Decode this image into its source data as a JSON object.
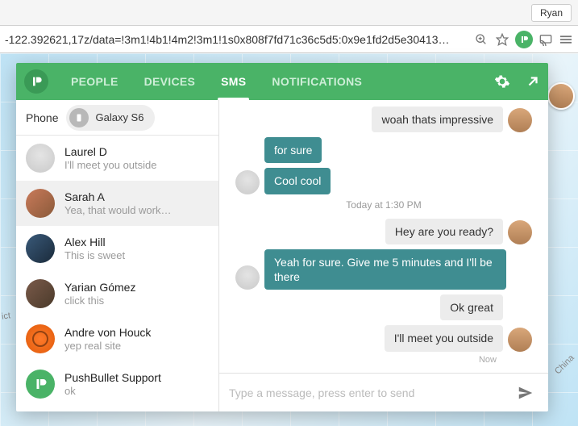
{
  "browser": {
    "user": "Ryan",
    "url": "-122.392621,17z/data=!3m1!4b1!4m2!3m1!1s0x808f7fd71c36c5d5:0x9e1fd2d5e30413…",
    "map_label_left": "ict",
    "map_label_right": "China"
  },
  "nav": {
    "tabs": [
      "PEOPLE",
      "DEVICES",
      "SMS",
      "NOTIFICATIONS"
    ],
    "active_index": 2
  },
  "device": {
    "label": "Phone",
    "name": "Galaxy S6"
  },
  "conversations": [
    {
      "name": "Laurel D",
      "preview": "I'll meet you outside",
      "avatar": "av-grey",
      "selected": false
    },
    {
      "name": "Sarah A",
      "preview": "Yea, that would work…",
      "avatar": "av-photo1",
      "selected": true
    },
    {
      "name": "Alex Hill",
      "preview": "This is sweet",
      "avatar": "av-photo2",
      "selected": false
    },
    {
      "name": "Yarian Gómez",
      "preview": "click this",
      "avatar": "av-photo3",
      "selected": false
    },
    {
      "name": "Andre von Houck",
      "preview": "yep real site",
      "avatar": "av-orange",
      "selected": false
    },
    {
      "name": "PushBullet Support",
      "preview": "ok",
      "avatar": "av-green",
      "selected": false
    }
  ],
  "chat": {
    "timestamp": "Today at 1:30 PM",
    "meta": "Now",
    "messages_top": [
      {
        "side": "out",
        "text": "woah thats impressive",
        "show_avatar": true
      },
      {
        "side": "in",
        "text": "for sure",
        "show_avatar": false
      },
      {
        "side": "in",
        "text": "Cool cool",
        "show_avatar": true
      }
    ],
    "messages_bottom": [
      {
        "side": "out",
        "text": "Hey are you ready?",
        "show_avatar": true
      },
      {
        "side": "in",
        "text": "Yeah for sure. Give me 5 minutes and I'll be there",
        "show_avatar": true
      },
      {
        "side": "out",
        "text": "Ok great",
        "show_avatar": false
      },
      {
        "side": "out",
        "text": "I'll meet you outside",
        "show_avatar": true
      }
    ],
    "compose_placeholder": "Type a message, press enter to send"
  },
  "colors": {
    "brand": "#4ab367",
    "bubble_in": "#3f8d91",
    "bubble_out": "#ececec"
  }
}
